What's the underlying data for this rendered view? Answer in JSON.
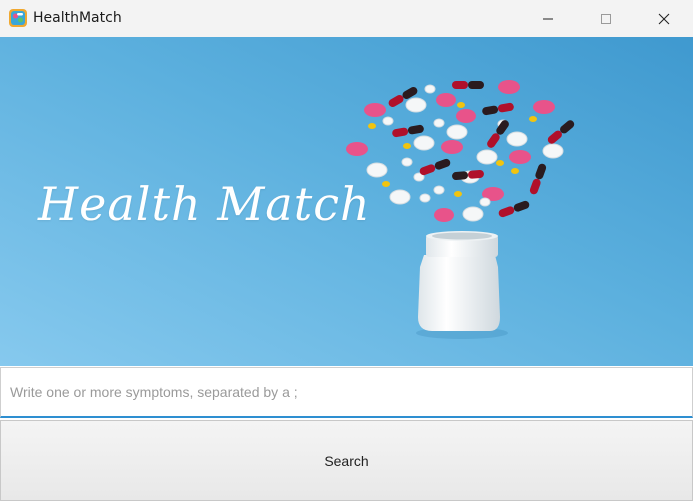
{
  "window": {
    "title": "HealthMatch",
    "icons": {
      "app": "health-app-icon",
      "minimize": "minimize-icon",
      "maximize": "maximize-icon",
      "close": "close-icon"
    }
  },
  "banner": {
    "title": "Health Match",
    "background_color": "#4fa8d8"
  },
  "search": {
    "placeholder": "Write one or more symptoms, separated by a ;",
    "value": "",
    "button_label": "Search"
  },
  "colors": {
    "accent": "#2e8fd1",
    "pill_pink": "#e8538a",
    "pill_red": "#b0102a"
  }
}
